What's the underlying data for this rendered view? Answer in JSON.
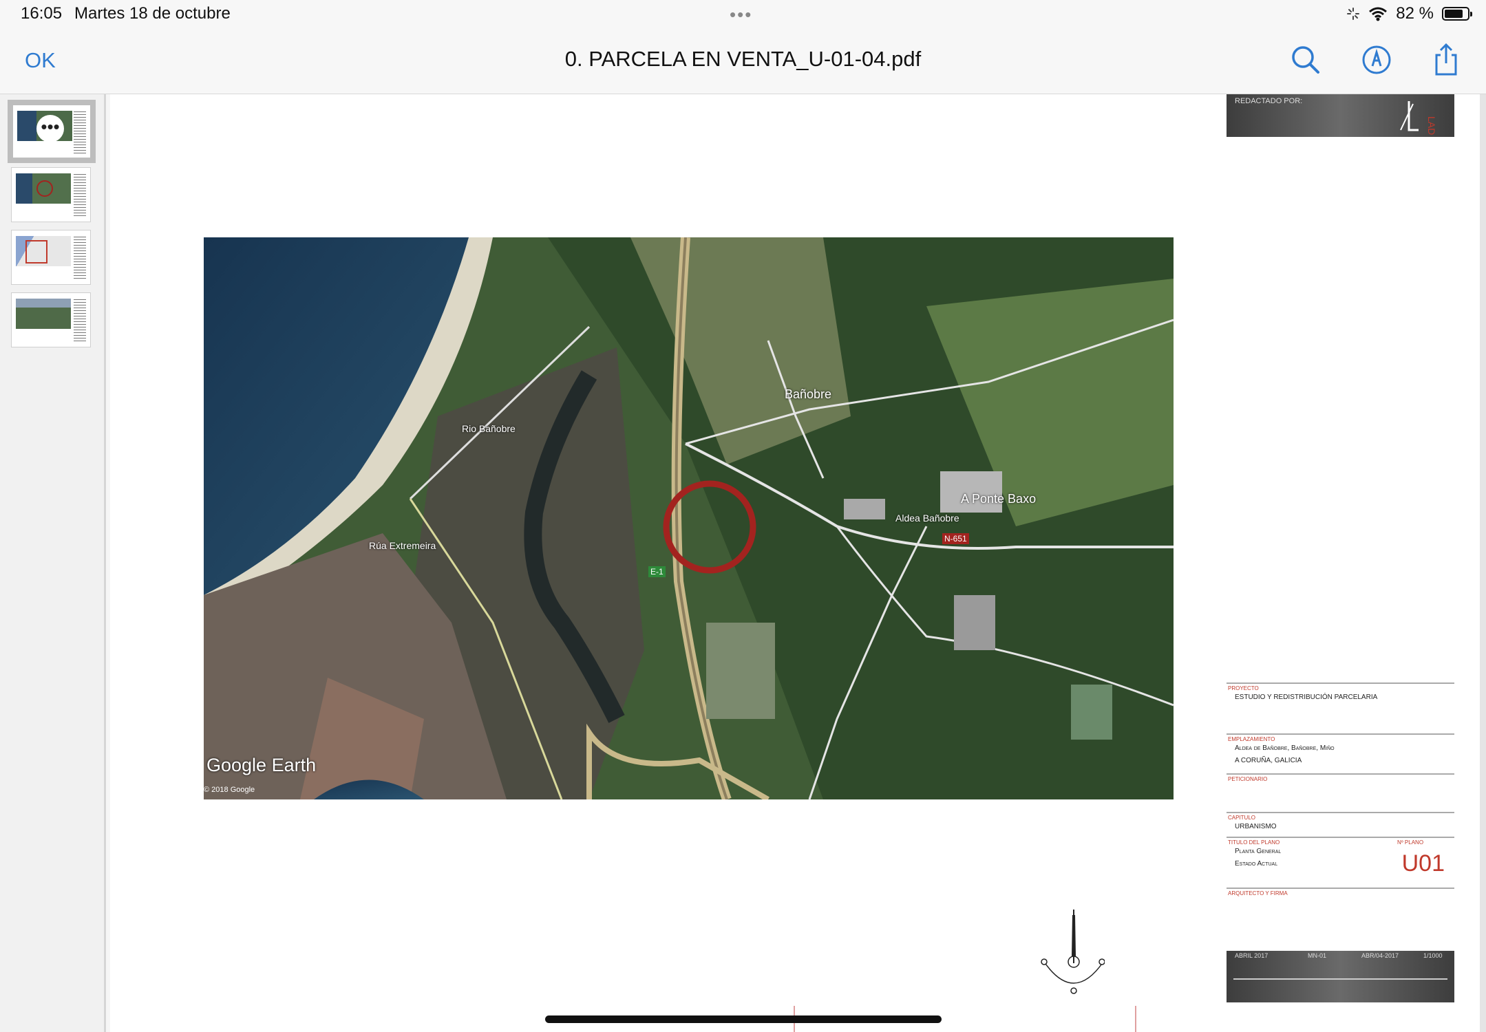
{
  "status": {
    "time": "16:05",
    "date": "Martes 18 de octubre",
    "dots": "•••",
    "battery_text": "82 %",
    "battery_level": 0.82
  },
  "toolbar": {
    "done_label": "OK",
    "title": "0. PARCELA EN VENTA_U-01-04.pdf",
    "icons": [
      "search-icon",
      "markup-icon",
      "share-icon"
    ]
  },
  "sidebar": {
    "more_label": "•••",
    "thumbnails": [
      "page-1",
      "page-2",
      "page-3",
      "page-4"
    ]
  },
  "map": {
    "labels": {
      "banobre": "Bañobre",
      "ponte_baxo": "A Ponte Baxo",
      "aldea": "Aldea Bañobre",
      "n651": "N-651",
      "e1": "E-1",
      "rua_extremeira": "Rúa Extremeira",
      "rio_banobre": "Rio Bañobre",
      "google_earth": "Google Earth",
      "copyright": "© 2018 Google"
    },
    "colors": {
      "marker": "#a3231f",
      "sea": "#1d3d5c",
      "land": "#3d5a33"
    }
  },
  "titleblock": {
    "header_label": "REDACTADO POR:",
    "proyecto_label": "PROYECTO",
    "proyecto_value": "ESTUDIO Y REDISTRIBUCIÓN PARCELARIA",
    "emplazamiento_label": "EMPLAZAMIENTO",
    "emplazamiento_line1": "Aldea de Bañobre, Bañobre, Miño",
    "emplazamiento_line2": "A CORUÑA, GALICIA",
    "peticionario_label": "PETICIONARIO",
    "capitulo_label": "CAPITULO",
    "capitulo_value": "URBANISMO",
    "titulo_label": "TITULO DEL PLANO",
    "titulo_line1": "Planta General",
    "titulo_line2": "Estado Actual",
    "numero_label": "Nº PLANO",
    "numero_value": "U01",
    "arquitecto_label": "ARQUITECTO Y FIRMA",
    "footer_date": "ABRIL 2017",
    "footer_code": "MN-01",
    "footer_date2": "ABR/04-2017",
    "footer_scale": "1/1000"
  }
}
